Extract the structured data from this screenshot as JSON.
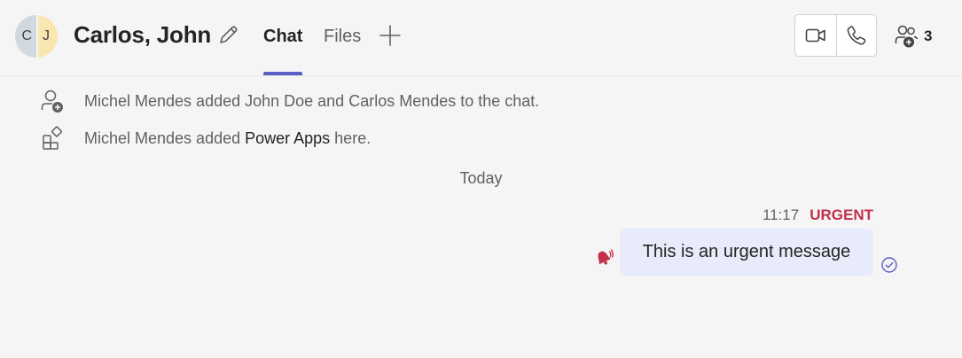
{
  "header": {
    "avatar": {
      "left_initial": "C",
      "right_initial": "J"
    },
    "title": "Carlos, John",
    "tabs": [
      {
        "label": "Chat",
        "active": true
      },
      {
        "label": "Files",
        "active": false
      }
    ],
    "participants_count": "3"
  },
  "icons": {
    "edit": "pencil-icon",
    "add_tab": "plus-icon",
    "video": "video-camera-icon",
    "call": "phone-icon",
    "people": "people-add-icon",
    "member_added": "person-add-icon",
    "app_added": "apps-icon",
    "urgent": "urgent-bell-icon",
    "read": "check-circle-icon"
  },
  "system_messages": [
    {
      "prefix": "Michel Mendes added John Doe and Carlos Mendes to the chat.",
      "highlight": "",
      "suffix": ""
    },
    {
      "prefix": "Michel Mendes added ",
      "highlight": "Power Apps",
      "suffix": " here."
    }
  ],
  "date_divider": "Today",
  "message": {
    "time": "11:17",
    "importance": "URGENT",
    "text": "This is an urgent message"
  },
  "colors": {
    "accent": "#5b5fc7",
    "urgent": "#c4314b",
    "bubble": "#e8ebfa",
    "background": "#f5f5f5"
  }
}
